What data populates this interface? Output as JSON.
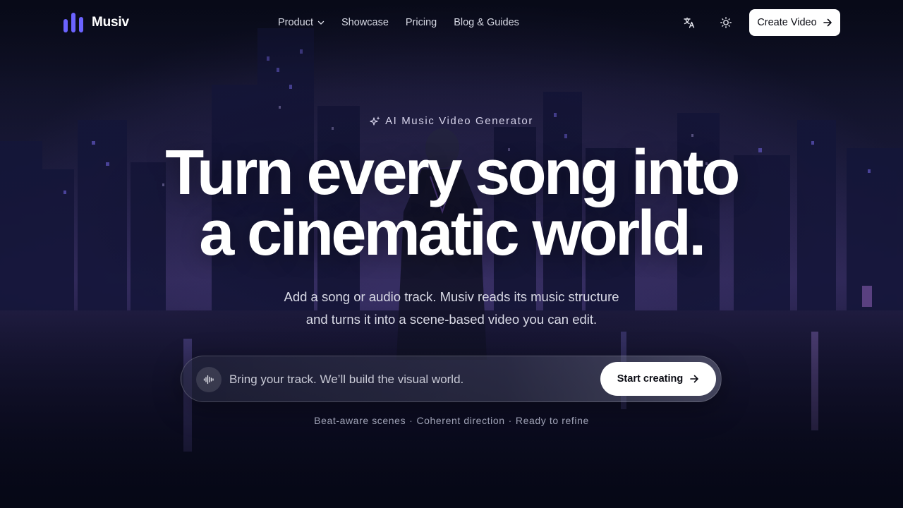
{
  "brand": {
    "name": "Musiv",
    "logo_icon": "bars-logo-icon",
    "accent": "#6b63ff"
  },
  "nav": {
    "items": [
      {
        "label": "Product",
        "has_dropdown": true
      },
      {
        "label": "Showcase"
      },
      {
        "label": "Pricing"
      },
      {
        "label": "Blog & Guides"
      }
    ],
    "translate_icon": "translate-icon",
    "theme_icon": "sun-icon",
    "cta_label": "Create Video"
  },
  "hero": {
    "eyebrow": "AI Music Video Generator",
    "title_line1": "Turn every song into",
    "title_line2": "a cinematic world.",
    "subtitle_line1": "Add a song or audio track. Musiv reads its music structure",
    "subtitle_line2": "and turns it into a scene-based video you can edit."
  },
  "prompt": {
    "placeholder": "Bring your track. We’ll build the visual world.",
    "value": "",
    "button_label": "Start creating"
  },
  "features": [
    "Beat-aware scenes",
    "Coherent direction",
    "Ready to refine"
  ],
  "colors": {
    "background": "#080a18",
    "button_bg": "#ffffff",
    "button_text": "#0b0c14",
    "muted_text": "#9fa2b6"
  }
}
